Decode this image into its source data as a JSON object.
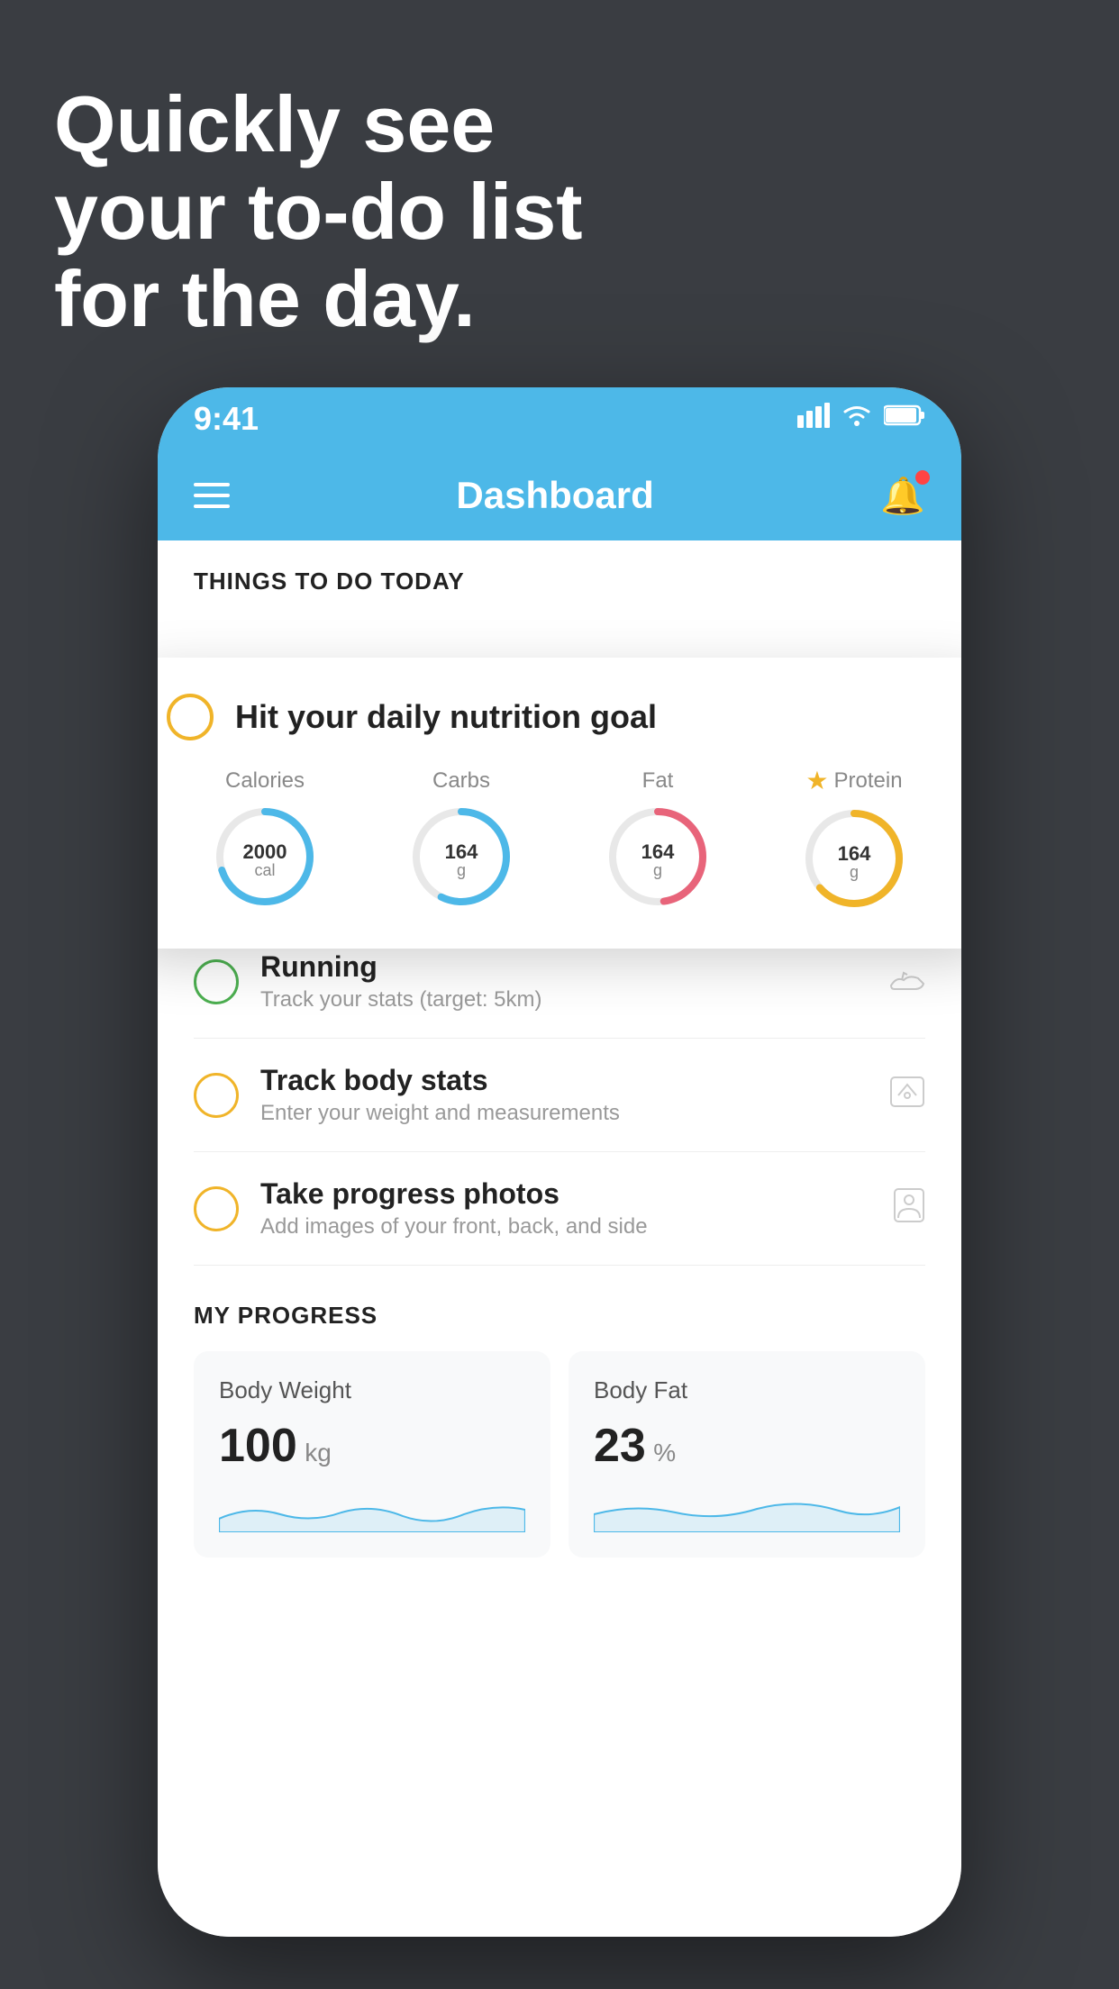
{
  "background": {
    "color": "#3a3d42"
  },
  "headline": {
    "line1": "Quickly see",
    "line2": "your to-do list",
    "line3": "for the day."
  },
  "phone": {
    "status_bar": {
      "time": "9:41",
      "signal_icon": "▋▋▋▋",
      "wifi_icon": "wifi",
      "battery_icon": "battery"
    },
    "nav_bar": {
      "title": "Dashboard",
      "menu_icon": "hamburger",
      "bell_icon": "bell"
    },
    "section_header": "THINGS TO DO TODAY",
    "floating_card": {
      "check_color": "#f0b429",
      "title": "Hit your daily nutrition goal",
      "nutrients": [
        {
          "label": "Calories",
          "value": "2000",
          "unit": "cal",
          "color": "#4db8e8",
          "starred": false
        },
        {
          "label": "Carbs",
          "value": "164",
          "unit": "g",
          "color": "#4db8e8",
          "starred": false
        },
        {
          "label": "Fat",
          "value": "164",
          "unit": "g",
          "color": "#e8647a",
          "starred": false
        },
        {
          "label": "Protein",
          "value": "164",
          "unit": "g",
          "color": "#f0b429",
          "starred": true
        }
      ]
    },
    "todo_items": [
      {
        "id": "running",
        "circle_color": "green",
        "title": "Running",
        "subtitle": "Track your stats (target: 5km)",
        "icon": "shoe"
      },
      {
        "id": "body-stats",
        "circle_color": "yellow",
        "title": "Track body stats",
        "subtitle": "Enter your weight and measurements",
        "icon": "scale"
      },
      {
        "id": "progress-photos",
        "circle_color": "yellow",
        "title": "Take progress photos",
        "subtitle": "Add images of your front, back, and side",
        "icon": "person"
      }
    ],
    "progress_section": {
      "header": "MY PROGRESS",
      "cards": [
        {
          "id": "body-weight",
          "title": "Body Weight",
          "value": "100",
          "unit": "kg"
        },
        {
          "id": "body-fat",
          "title": "Body Fat",
          "value": "23",
          "unit": "%"
        }
      ]
    }
  }
}
